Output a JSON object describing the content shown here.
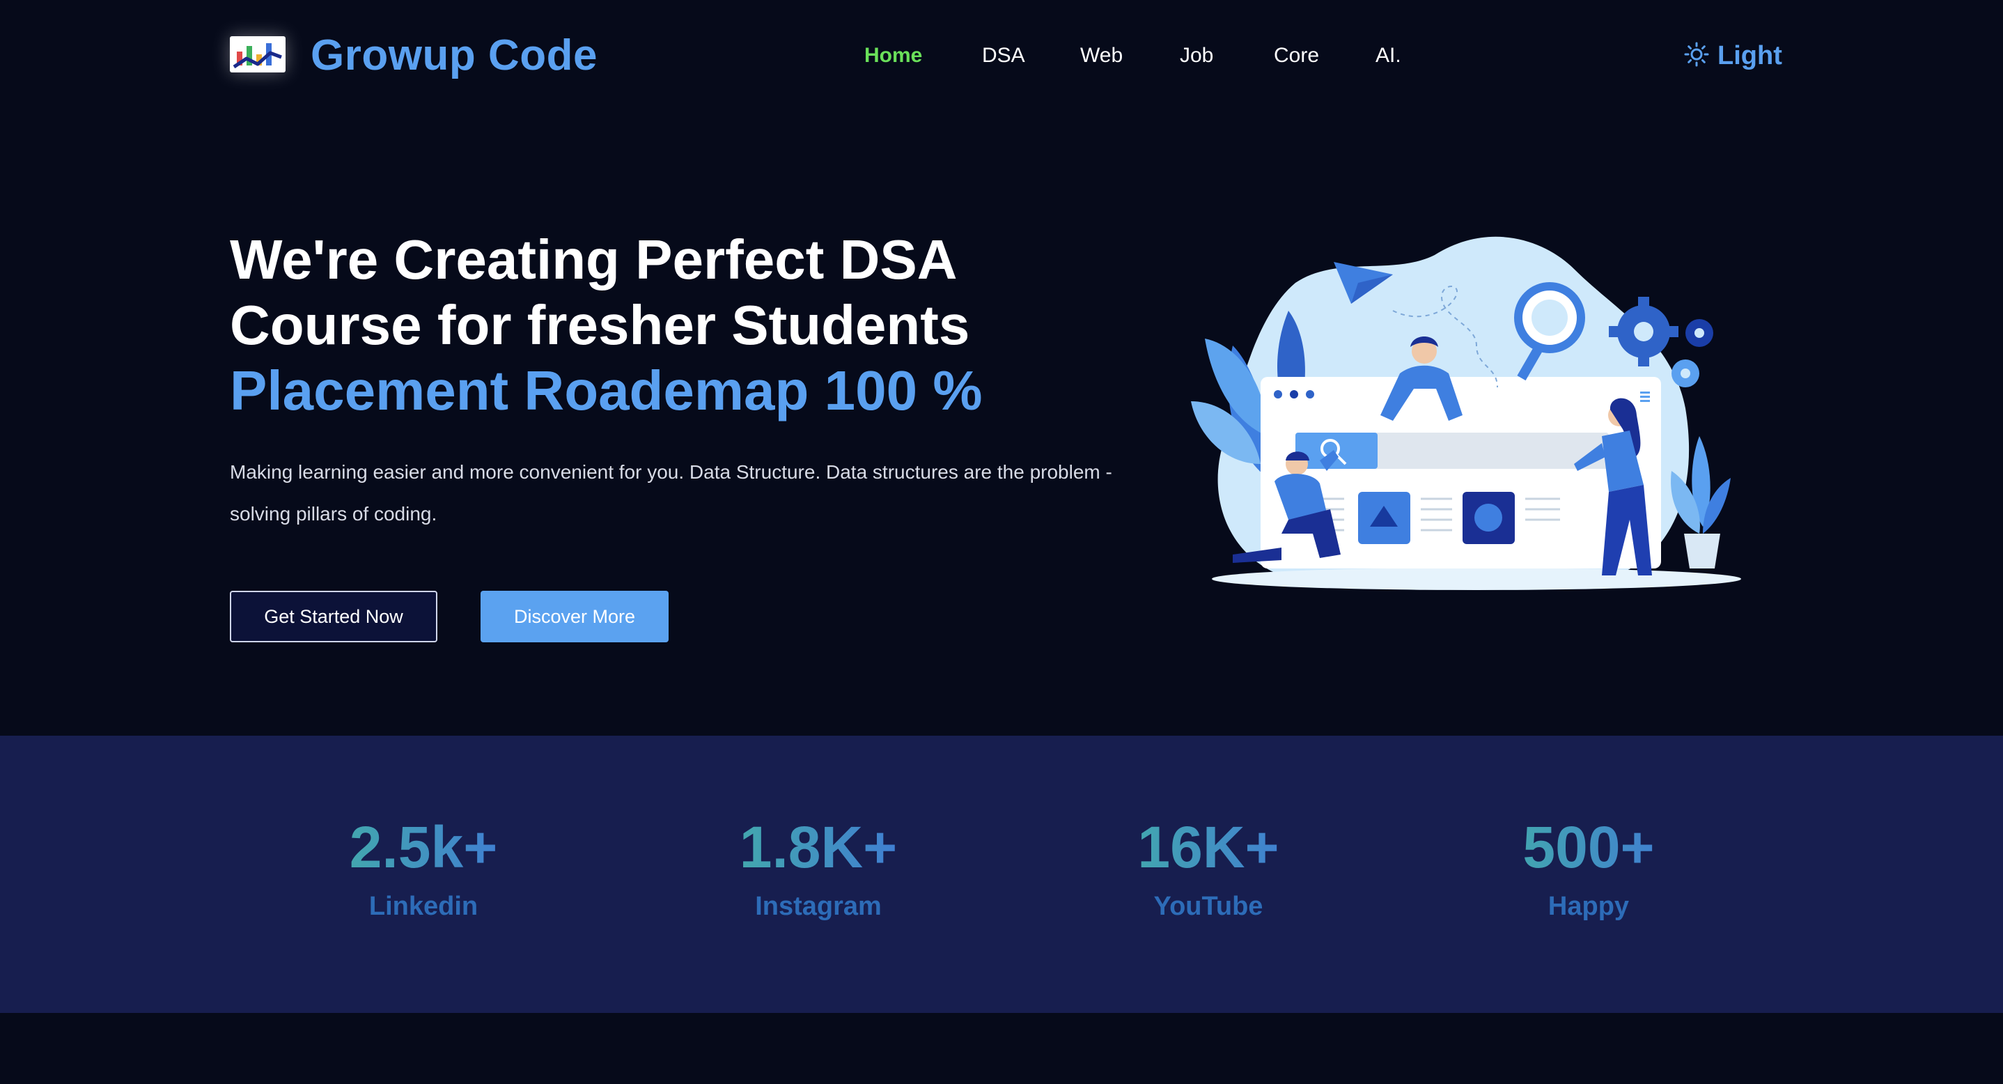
{
  "brand": {
    "name": "Growup Code",
    "logo_icon": "chart-logo-icon"
  },
  "nav": {
    "items": [
      {
        "label": "Home",
        "active": true
      },
      {
        "label": "DSA",
        "active": false
      },
      {
        "label": "Web",
        "active": false
      },
      {
        "label": "Job",
        "active": false
      },
      {
        "label": "Core",
        "active": false
      },
      {
        "label": "AI.",
        "active": false
      }
    ]
  },
  "theme_toggle": {
    "label": "Light",
    "icon": "sun-icon"
  },
  "hero": {
    "title_line1": "We're Creating Perfect DSA",
    "title_line2": "Course for fresher Students",
    "title_accent": "Placement Roademap 100 %",
    "description": "Making learning easier and more convenient for you. Data Structure. Data structures are the problem - solving pillars of coding.",
    "primary_button": "Get Started Now",
    "secondary_button": "Discover More"
  },
  "stats": [
    {
      "value": "2.5k+",
      "label": "Linkedin"
    },
    {
      "value": "1.8K+",
      "label": "Instagram"
    },
    {
      "value": "16K+",
      "label": "YouTube"
    },
    {
      "value": "500+",
      "label": "Happy"
    }
  ],
  "colors": {
    "background": "#060a1a",
    "accent": "#5aa0f0",
    "nav_active": "#6ae05a",
    "stats_band": "#171e4f",
    "stat_label": "#2d6cb8"
  }
}
